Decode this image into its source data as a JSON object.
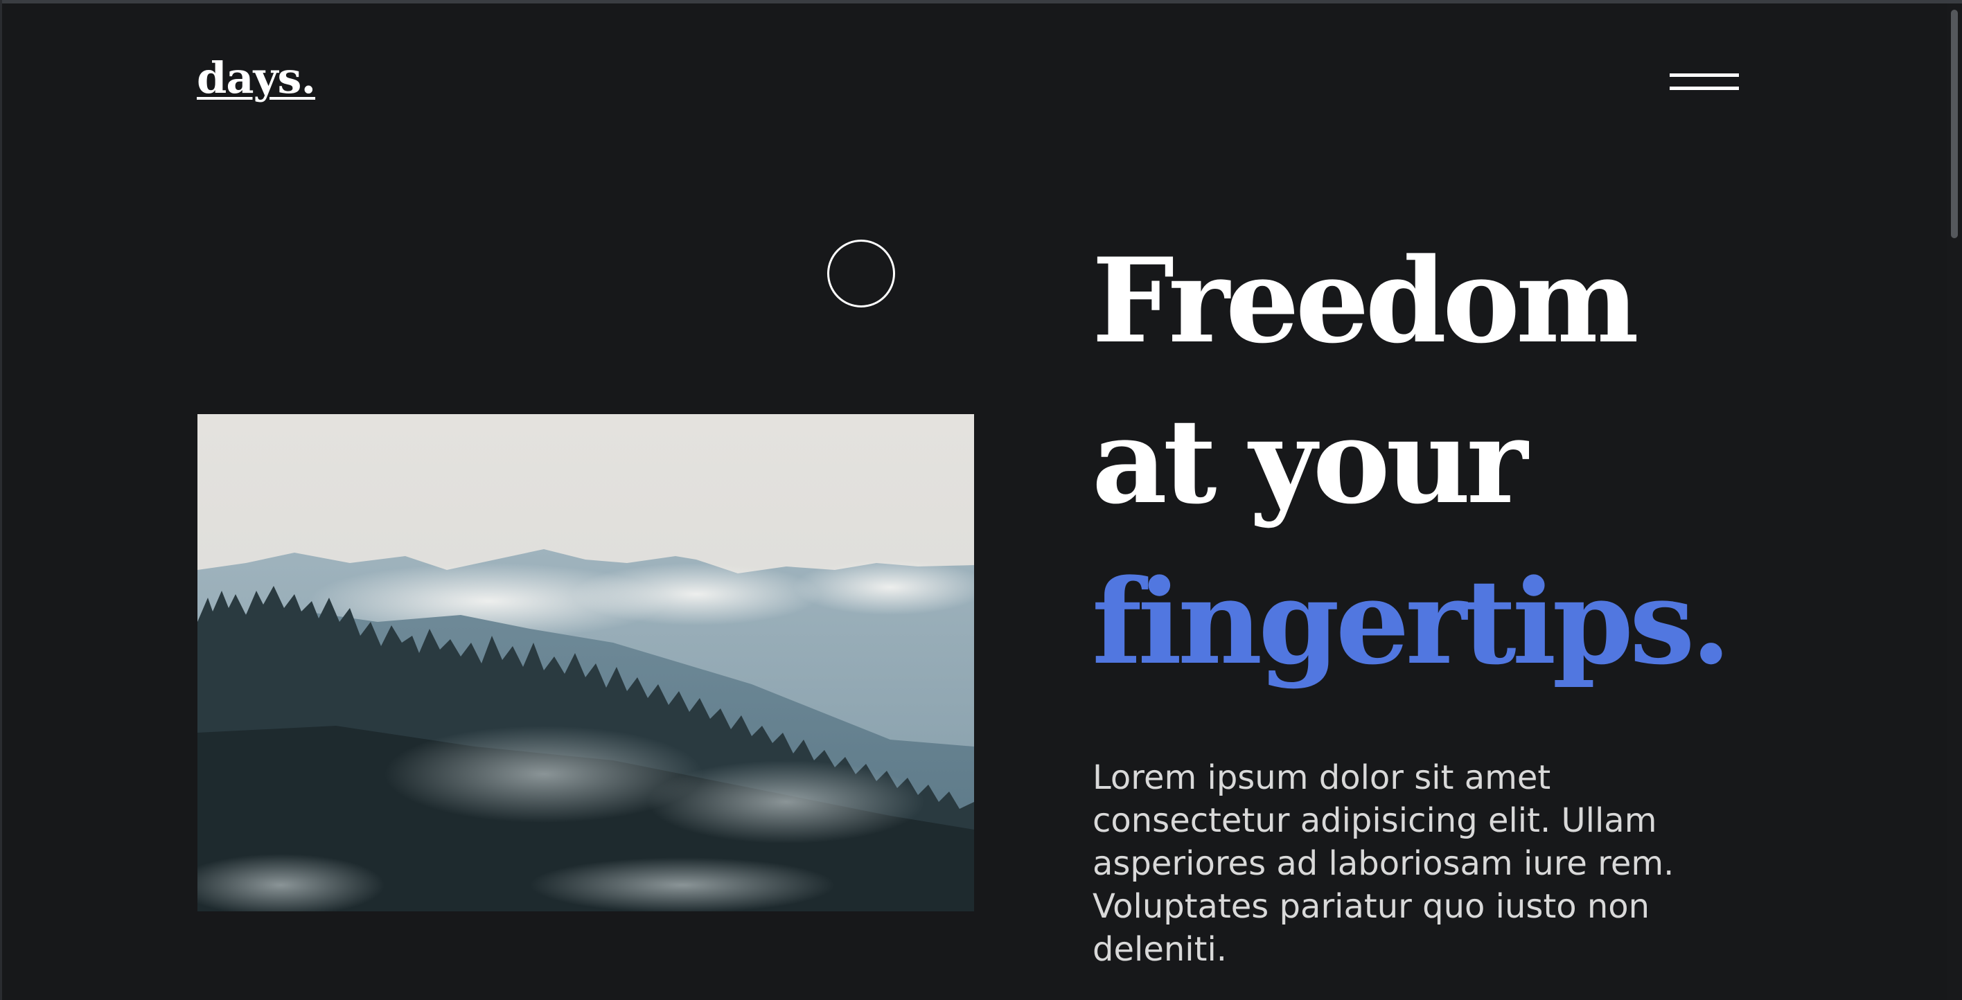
{
  "header": {
    "logo_text": "days.",
    "menu_icon": "hamburger-icon"
  },
  "hero": {
    "headline_line1": "Freedom",
    "headline_line2": "at your",
    "headline_line3": "fingertips.",
    "description": "Lorem ipsum dolor sit amet consectetur adipisicing elit. Ullam asperiores ad laboriosam iure rem. Voluptates pariatur quo iusto non deleniti.",
    "image_subject": "misty mountain forest landscape",
    "cursor_icon": "cursor-ring-icon"
  },
  "colors": {
    "background": "#17181a",
    "text": "#ffffff",
    "accent": "#5177e0",
    "body_text": "#d9d9d9"
  }
}
